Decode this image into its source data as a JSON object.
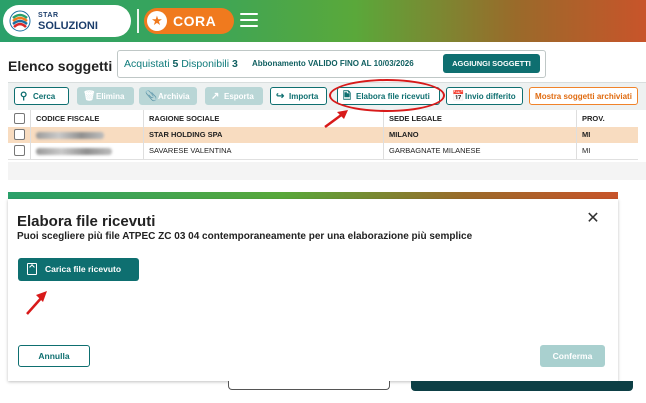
{
  "header": {
    "logo_line1": "STAR",
    "logo_line2": "SOLUZIONI",
    "app_name": "CORA",
    "app_star": "★",
    "brand_orange": "#f07a1e",
    "brand_teal": "#0e6f70"
  },
  "page": {
    "title": "Elenco soggetti",
    "acquistati_label": "Acquistati",
    "acquistati_value": "5",
    "disponibili_label": "Disponibili",
    "disponibili_value": "3",
    "abbonamento": "Abbonamento VALIDO FINO AL 10/03/2026",
    "add_button": "AGGIUNGI SOGGETTI"
  },
  "toolbar": {
    "cerca": "Cerca",
    "elimina": "Elimina",
    "archivia": "Archivia",
    "esporta": "Esporta",
    "importa": "Importa",
    "elabora": "Elabora file ricevuti",
    "invio": "Invio differito",
    "mostra": "Mostra soggetti archiviati"
  },
  "table": {
    "columns": [
      "CODICE FISCALE",
      "RAGIONE SOCIALE",
      "SEDE LEGALE",
      "PROV."
    ],
    "rows": [
      {
        "ragione_sociale": "STAR HOLDING SPA",
        "sede": "MILANO",
        "prov": "MI",
        "selected": true
      },
      {
        "ragione_sociale": "SAVARESE VALENTINA",
        "sede": "GARBAGNATE MILANESE",
        "prov": "MI",
        "selected": false
      }
    ]
  },
  "modal": {
    "title": "Elabora file ricevuti",
    "subtitle": "Puoi scegliere più file ATPEC ZC 03 04 contemporaneamente per una elaborazione più semplice",
    "close": "✕",
    "upload_button": "Carica file ricevuto",
    "cancel_button": "Annulla",
    "confirm_button": "Conferma"
  },
  "annotation_color": "#d81a1a"
}
